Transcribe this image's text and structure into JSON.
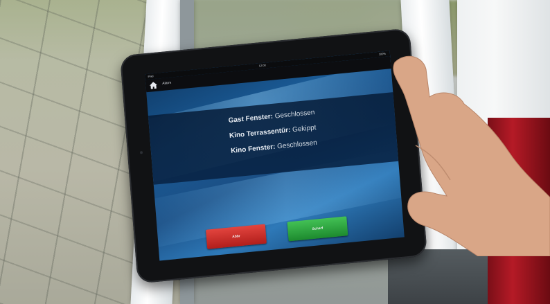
{
  "tablet": {
    "status_bar": {
      "carrier": "iPad",
      "time": "12:00",
      "battery": "100%"
    },
    "nav": {
      "title": "Alarm",
      "home_icon": "home-icon"
    },
    "status_items": [
      {
        "label": "Gast Fenster:",
        "value": "Geschlossen"
      },
      {
        "label": "Kino Terrassentür:",
        "value": "Gekippt"
      },
      {
        "label": "Kino Fenster:",
        "value": "Geschlossen"
      }
    ],
    "buttons": {
      "red_label": "Abbr",
      "green_label": "Scharf",
      "red_color": "#c9302c",
      "green_color": "#2ea043"
    }
  }
}
